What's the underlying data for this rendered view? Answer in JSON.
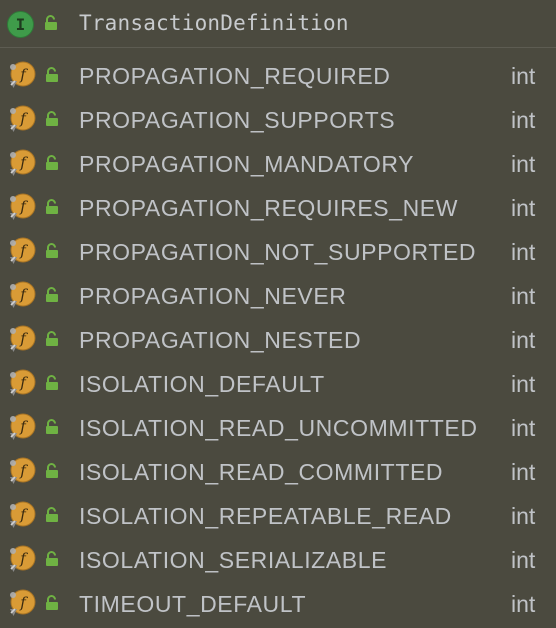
{
  "header": {
    "icon": "interface-icon",
    "icon_letter": "I",
    "access_icon": "public-lock-icon",
    "title": "TransactionDefinition"
  },
  "colors": {
    "background": "#4b4a3f",
    "interface_icon": "#3f9b4a",
    "field_icon": "#d99b36",
    "lock": "#6fb243",
    "text": "#c0c3c7"
  },
  "fields": [
    {
      "name": "PROPAGATION_REQUIRED",
      "type": "int"
    },
    {
      "name": "PROPAGATION_SUPPORTS",
      "type": "int"
    },
    {
      "name": "PROPAGATION_MANDATORY",
      "type": "int"
    },
    {
      "name": "PROPAGATION_REQUIRES_NEW",
      "type": "int"
    },
    {
      "name": "PROPAGATION_NOT_SUPPORTED",
      "type": "int"
    },
    {
      "name": "PROPAGATION_NEVER",
      "type": "int"
    },
    {
      "name": "PROPAGATION_NESTED",
      "type": "int"
    },
    {
      "name": "ISOLATION_DEFAULT",
      "type": "int"
    },
    {
      "name": "ISOLATION_READ_UNCOMMITTED",
      "type": "int"
    },
    {
      "name": "ISOLATION_READ_COMMITTED",
      "type": "int"
    },
    {
      "name": "ISOLATION_REPEATABLE_READ",
      "type": "int"
    },
    {
      "name": "ISOLATION_SERIALIZABLE",
      "type": "int"
    },
    {
      "name": "TIMEOUT_DEFAULT",
      "type": "int"
    }
  ],
  "field_icon": "static-final-field-icon",
  "field_icon_letter": "f"
}
